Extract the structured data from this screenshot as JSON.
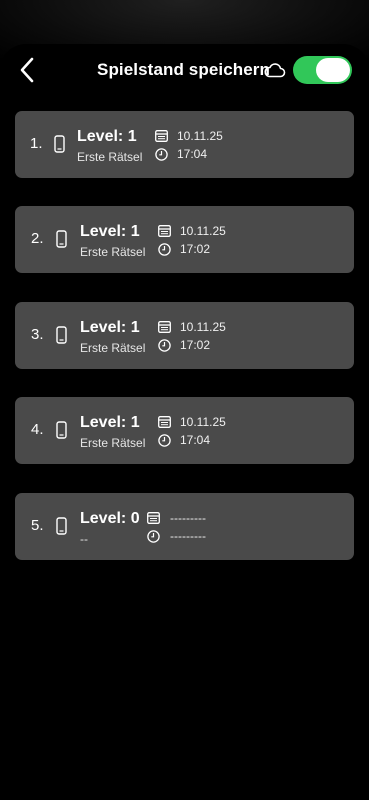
{
  "header": {
    "title": "Spielstand speichern",
    "back_icon": "chevron-left-icon",
    "cloud_icon": "cloud-icon",
    "cloud_sync_enabled": true,
    "toggle_color": "#31c759"
  },
  "slots": [
    {
      "number": "1.",
      "level": "Level: 1",
      "subtitle": "Erste Rätsel",
      "date": "10.11.25",
      "time": "17:04"
    },
    {
      "number": "2.",
      "level": "Level: 1",
      "subtitle": "Erste Rätsel",
      "date": "10.11.25",
      "time": "17:02"
    },
    {
      "number": "3.",
      "level": "Level: 1",
      "subtitle": "Erste Rätsel",
      "date": "10.11.25",
      "time": "17:02"
    },
    {
      "number": "4.",
      "level": "Level: 1",
      "subtitle": "Erste Rätsel",
      "date": "10.11.25",
      "time": "17:04"
    },
    {
      "number": "5.",
      "level": "Level: 0",
      "subtitle": "--",
      "date": "---------",
      "time": "---------"
    }
  ],
  "colors": {
    "background": "#000000",
    "slot_background": "#4a4a4a"
  }
}
